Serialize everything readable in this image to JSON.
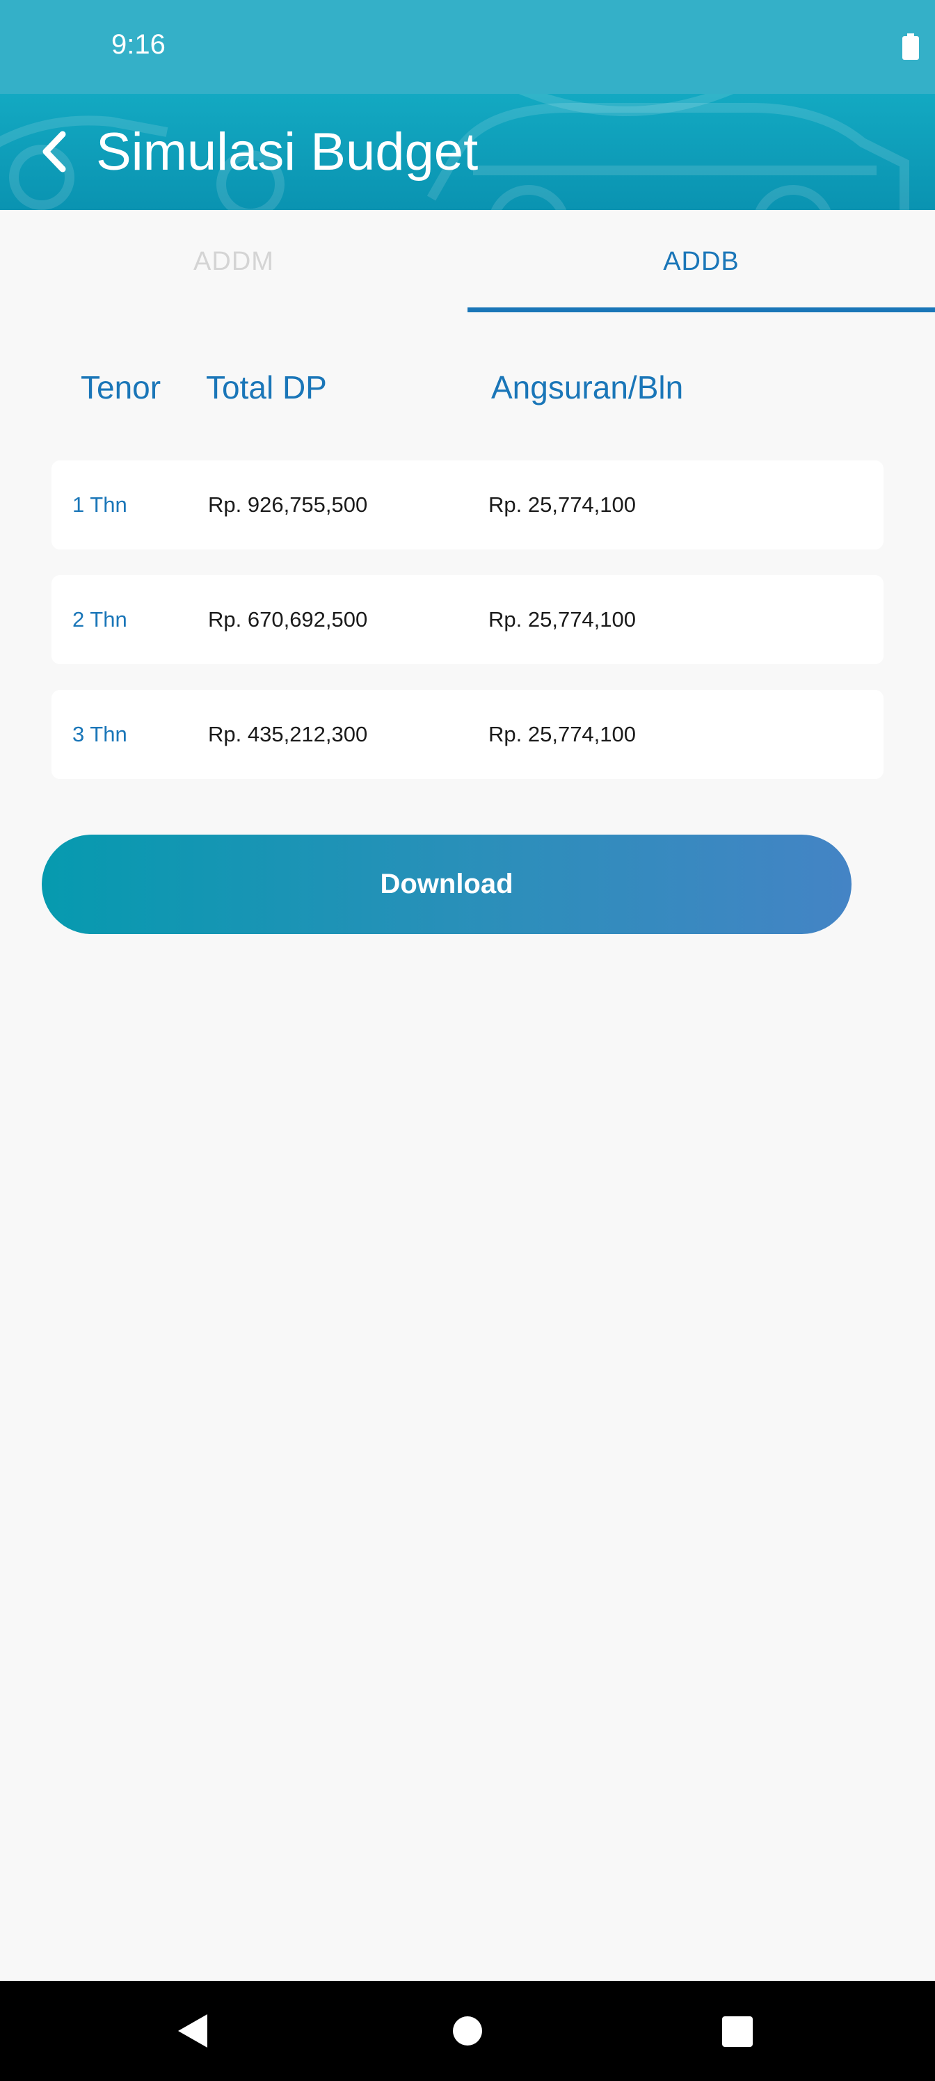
{
  "status_bar": {
    "time": "9:16",
    "battery_icon": "battery-full-icon"
  },
  "app_bar": {
    "title": "Simulasi Budget",
    "back_icon": "chevron-left-icon"
  },
  "tabs": [
    {
      "label": "ADDM",
      "selected": false
    },
    {
      "label": "ADDB",
      "selected": true
    }
  ],
  "table": {
    "headers": [
      "Tenor",
      "Total DP",
      "Angsuran/Bln"
    ],
    "rows": [
      {
        "tenor": "1 Thn",
        "total_dp": "Rp. 926,755,500",
        "angsuran": "Rp. 25,774,100"
      },
      {
        "tenor": "2 Thn",
        "total_dp": "Rp. 670,692,500",
        "angsuran": "Rp. 25,774,100"
      },
      {
        "tenor": "3 Thn",
        "total_dp": "Rp. 435,212,300",
        "angsuran": "Rp. 25,774,100"
      }
    ]
  },
  "download_label": "Download",
  "nav_bar": {
    "back_icon": "triangle-back-icon",
    "home_icon": "circle-home-icon",
    "recents_icon": "square-recents-icon"
  },
  "colors": {
    "accent": "#1a76b8",
    "header": "#13a9c2",
    "status_bar": "#34b0c8",
    "background": "#f8f8f8"
  }
}
